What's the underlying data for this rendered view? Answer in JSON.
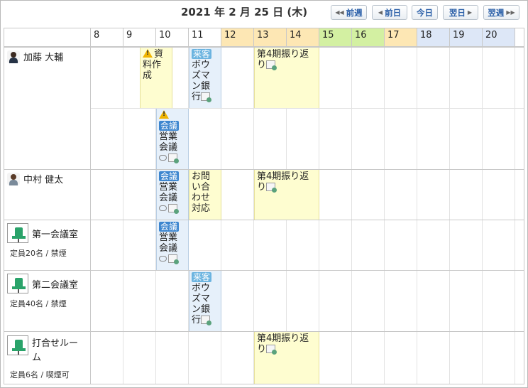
{
  "header": {
    "date": "2021 年 2 月 25 日 (木)",
    "prev_week": "前週",
    "prev_day": "前日",
    "today": "今日",
    "next_day": "翌日",
    "next_week": "翌週"
  },
  "hours": [
    {
      "label": "8",
      "color": "#ffffff"
    },
    {
      "label": "9",
      "color": "#ffffff"
    },
    {
      "label": "10",
      "color": "#ffffff"
    },
    {
      "label": "11",
      "color": "#ffffff"
    },
    {
      "label": "12",
      "color": "#fde7b4"
    },
    {
      "label": "13",
      "color": "#fde7b4"
    },
    {
      "label": "14",
      "color": "#fde7b4"
    },
    {
      "label": "15",
      "color": "#d3f0a2"
    },
    {
      "label": "16",
      "color": "#d3f0a2"
    },
    {
      "label": "17",
      "color": "#fde7b4"
    },
    {
      "label": "18",
      "color": "#dde7f7"
    },
    {
      "label": "19",
      "color": "#dde7f7"
    },
    {
      "label": "20",
      "color": "#dde7f7"
    }
  ],
  "rows": {
    "kato": {
      "name": "加藤 大輔"
    },
    "nakamura": {
      "name": "中村 健太"
    },
    "room1": {
      "name": "第一会議室",
      "detail": "定員20名 / 禁煙"
    },
    "room2": {
      "name": "第二会議室",
      "detail": "定員40名 / 禁煙"
    },
    "room3": {
      "name": "打合せルーム",
      "detail": "定員6名 / 喫煙可"
    }
  },
  "events": {
    "shiryo": {
      "title": "資料作成"
    },
    "visit_bank": {
      "badge": "来客",
      "title": "ボウズマン銀行"
    },
    "review": {
      "title": "第4期振り返り"
    },
    "meeting": {
      "badge": "会議",
      "title": "営業会議"
    },
    "toiawase": {
      "title": "お問い合わせ対応"
    }
  },
  "colors": {
    "accent": "#2a5fa8",
    "event_yellow": "#fefdd0",
    "event_blue": "#e6f0fa"
  }
}
